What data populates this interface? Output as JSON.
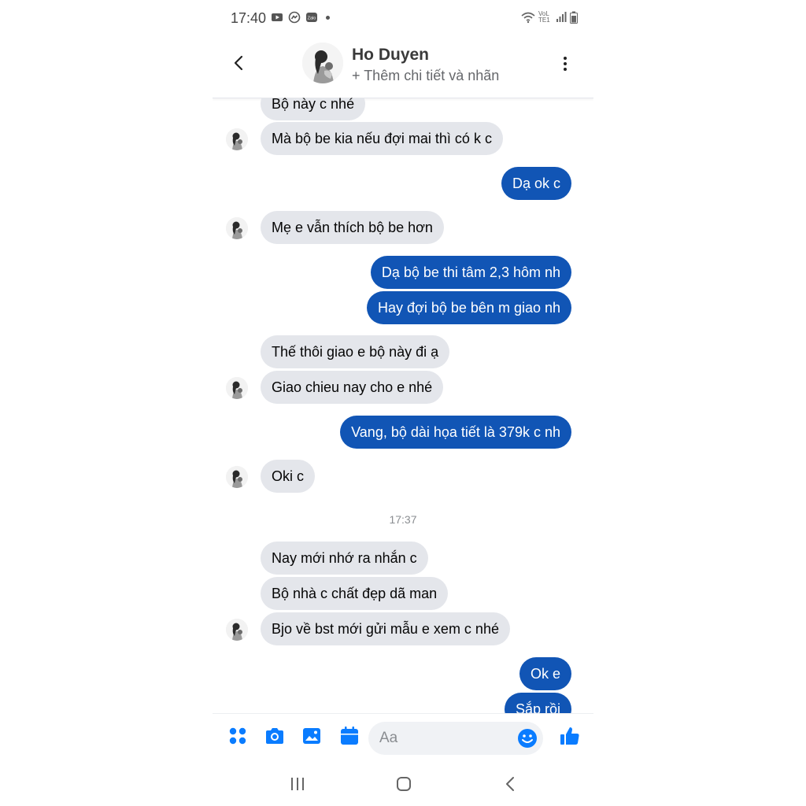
{
  "status_bar": {
    "time": "17:40",
    "left_icons": [
      "youtube-icon",
      "messenger-icon",
      "zalo-icon"
    ],
    "zalo_text": "Zalo",
    "network": "VoLTE1",
    "right_icons": [
      "wifi-icon",
      "volte-icon",
      "signal-icon",
      "battery-icon"
    ]
  },
  "header": {
    "name": "Ho Duyen",
    "subtitle": "+ Thêm chi tiết và nhãn"
  },
  "messages": [
    {
      "side": "in",
      "text": "Bộ này c nhé"
    },
    {
      "side": "in",
      "text": "Mà bộ be kia nếu đợi mai thì có k c"
    },
    {
      "side": "out",
      "text": "Dạ ok c"
    },
    {
      "side": "in",
      "text": "Mẹ e vẫn thích bộ be hơn"
    },
    {
      "side": "out",
      "text": "Dạ bộ be thi tâm 2,3 hôm nh"
    },
    {
      "side": "out",
      "text": "Hay đợi bộ be bên m giao nh"
    },
    {
      "side": "in",
      "text": "Thế thôi giao e bộ này đi ạ"
    },
    {
      "side": "in",
      "text": "Giao chieu nay cho e nhé"
    },
    {
      "side": "out",
      "text": "Vang, bộ dài họa tiết là 379k c nh"
    },
    {
      "side": "in",
      "text": "Oki c"
    },
    {
      "side": "in",
      "text": "Nay mới nhớ ra nhắn c"
    },
    {
      "side": "in",
      "text": "Bộ nhà c chất đẹp dã man"
    },
    {
      "side": "in",
      "text": "Bjo về bst mới gửi mẫu e xem c nhé"
    },
    {
      "side": "out",
      "text": "Ok e"
    },
    {
      "side": "out",
      "text": "Sắp rồi"
    }
  ],
  "timestamp": "17:37",
  "composer": {
    "placeholder": "Aa",
    "icons": [
      "apps-icon",
      "camera-icon",
      "image-icon",
      "calendar-icon",
      "emoji-icon",
      "thumbs-up-icon"
    ]
  },
  "colors": {
    "outgoing_bubble": "#1155b5",
    "incoming_bubble": "#e4e6eb",
    "accent": "#0a7cff"
  }
}
